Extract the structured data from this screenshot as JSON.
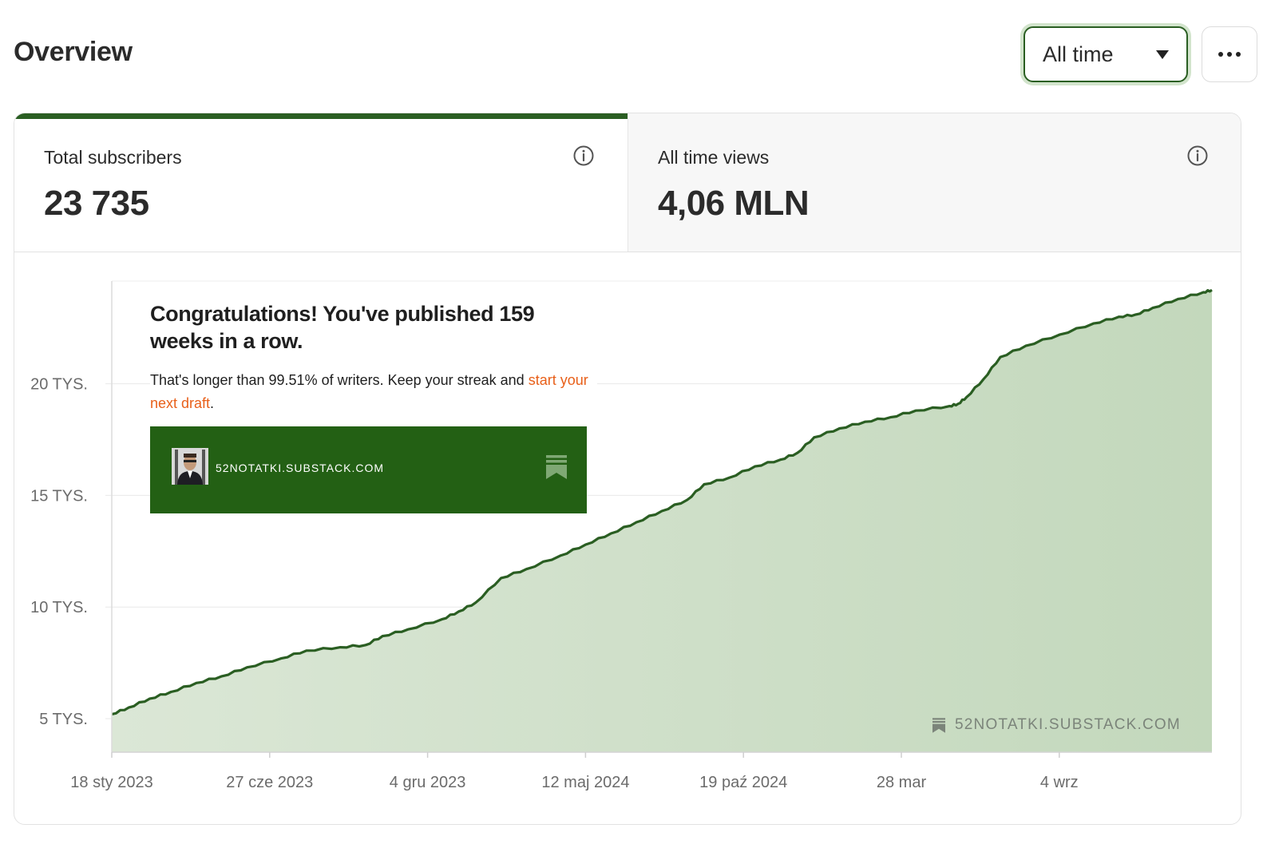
{
  "page": {
    "title": "Overview"
  },
  "toolbar": {
    "range_value": "All time"
  },
  "stats": [
    {
      "label": "Total subscribers",
      "value": "23 735"
    },
    {
      "label": "All time views",
      "value": "4,06 MLN"
    }
  ],
  "streak": {
    "title": "Congratulations! You've published 159 weeks in a row.",
    "text_before": "That's longer than 99.51% of writers. Keep your streak and ",
    "link": "start your next draft",
    "text_after": "."
  },
  "publication": {
    "name": "52NOTATKI.SUBSTACK.COM"
  },
  "watermark": {
    "text": "52NOTATKI.SUBSTACK.COM"
  },
  "colors": {
    "accent": "#2a5e22",
    "area_fill": "#c9dcc3",
    "link": "#e8601a"
  },
  "chart_data": {
    "type": "area",
    "title": "",
    "xlabel": "",
    "ylabel": "",
    "x_ticks": [
      "18 sty 2023",
      "27 cze 2023",
      "4 gru 2023",
      "12 maj 2024",
      "19 paź 2024",
      "28 mar",
      "4 wrz"
    ],
    "y_ticks": [
      {
        "value": 5000,
        "label": "5 TYS."
      },
      {
        "value": 10000,
        "label": "10 TYS."
      },
      {
        "value": 15000,
        "label": "15 TYS."
      },
      {
        "value": 20000,
        "label": "20 TYS."
      }
    ],
    "ylim": [
      3500,
      24600
    ],
    "x_tick_count": 7,
    "series": [
      {
        "values": [
          [
            0,
            5200
          ],
          [
            0.2,
            5500
          ],
          [
            0.45,
            5900
          ],
          [
            0.7,
            6200
          ],
          [
            1.0,
            6600
          ],
          [
            1.3,
            6900
          ],
          [
            1.6,
            7300
          ],
          [
            2.0,
            7700
          ],
          [
            2.3,
            8050
          ],
          [
            2.7,
            8200
          ],
          [
            3.0,
            8300
          ],
          [
            3.2,
            8700
          ],
          [
            3.5,
            9000
          ],
          [
            3.9,
            9450
          ],
          [
            4.1,
            9800
          ],
          [
            4.3,
            10200
          ],
          [
            4.6,
            11300
          ],
          [
            4.9,
            11700
          ],
          [
            5.3,
            12300
          ],
          [
            5.6,
            12800
          ],
          [
            5.9,
            13300
          ],
          [
            6.2,
            13800
          ],
          [
            6.5,
            14300
          ],
          [
            6.8,
            14800
          ],
          [
            7.0,
            15500
          ],
          [
            7.3,
            15800
          ],
          [
            7.6,
            16300
          ],
          [
            7.9,
            16600
          ],
          [
            8.1,
            16900
          ],
          [
            8.3,
            17600
          ],
          [
            8.6,
            18000
          ],
          [
            8.9,
            18300
          ],
          [
            9.2,
            18500
          ],
          [
            9.5,
            18800
          ],
          [
            9.9,
            19000
          ],
          [
            10.0,
            19100
          ],
          [
            10.1,
            19400
          ],
          [
            10.3,
            20200
          ],
          [
            10.5,
            21200
          ],
          [
            10.8,
            21700
          ],
          [
            11.2,
            22200
          ],
          [
            11.6,
            22700
          ],
          [
            11.9,
            23000
          ],
          [
            12.1,
            23100
          ],
          [
            12.3,
            23400
          ],
          [
            12.6,
            23800
          ],
          [
            12.9,
            24100
          ],
          [
            13.0,
            24200
          ]
        ]
      }
    ]
  }
}
